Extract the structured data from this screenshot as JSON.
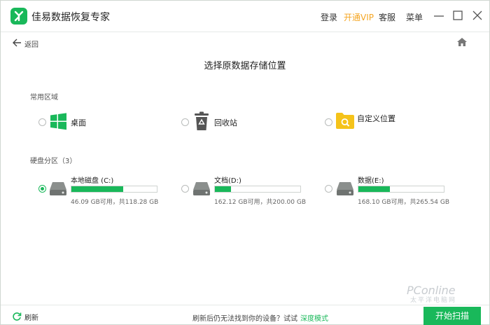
{
  "app": {
    "title": "佳易数据恢复专家"
  },
  "topbar": {
    "login": "登录",
    "vip": "开通VIP",
    "service": "客服",
    "menu": "菜单"
  },
  "nav": {
    "back": "返回"
  },
  "page": {
    "title": "选择原数据存储位置"
  },
  "common": {
    "label": "常用区域",
    "items": [
      {
        "label": "桌面",
        "icon": "windows-icon",
        "selected": false
      },
      {
        "label": "回收站",
        "icon": "recycle-bin-icon",
        "selected": false
      },
      {
        "label": "自定义位置",
        "icon": "folder-search-icon",
        "selected": false
      }
    ]
  },
  "drives": {
    "label": "硬盘分区（3）",
    "items": [
      {
        "name": "本地磁盘 (C:)",
        "info": "46.09 GB可用，共118.28 GB",
        "used_fraction": 0.61,
        "selected": true
      },
      {
        "name": "文档(D:)",
        "info": "162.12 GB可用，共200.00 GB",
        "used_fraction": 0.19,
        "selected": false
      },
      {
        "name": "数据(E:)",
        "info": "168.10 GB可用，共265.54 GB",
        "used_fraction": 0.37,
        "selected": false
      }
    ]
  },
  "footer": {
    "refresh": "刷新",
    "hint": "刷新后仍无法找到你的设备？试试",
    "deep_mode": "深度模式",
    "scan": "开始扫描"
  },
  "watermark": {
    "text": "PConline",
    "sub": "太平洋电脑网"
  },
  "colors": {
    "accent": "#19b85a",
    "vip": "#f5a623",
    "folder": "#f5c31a"
  }
}
